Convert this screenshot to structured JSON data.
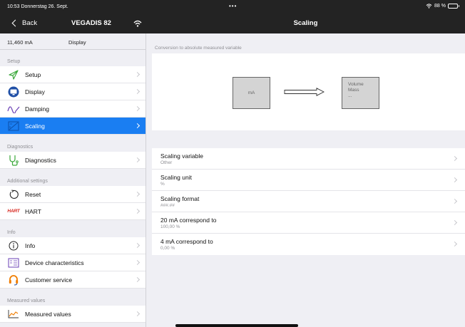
{
  "status": {
    "time": "10:53",
    "date": "Donnerstag 26. Sept.",
    "battery": "88 %",
    "battery_level": 0.88
  },
  "nav": {
    "back_label": "Back",
    "device_name": "VEGADIS 82",
    "title": "Scaling"
  },
  "sidebar": {
    "current_value": "11,460 mA",
    "display_label": "Display",
    "sections": [
      {
        "header": "Setup",
        "items": [
          {
            "label": "Setup",
            "icon": "setup-icon"
          },
          {
            "label": "Display",
            "icon": "display-icon"
          },
          {
            "label": "Damping",
            "icon": "damping-icon"
          },
          {
            "label": "Scaling",
            "icon": "scaling-icon",
            "active": true
          }
        ]
      },
      {
        "header": "Diagnostics",
        "items": [
          {
            "label": "Diagnostics",
            "icon": "stethoscope-icon"
          }
        ]
      },
      {
        "header": "Additional settings",
        "items": [
          {
            "label": "Reset",
            "icon": "reset-icon"
          },
          {
            "label": "HART",
            "icon": "hart-logo-icon",
            "icon_text": "HART"
          }
        ]
      },
      {
        "header": "Info",
        "items": [
          {
            "label": "Info",
            "icon": "info-icon"
          },
          {
            "label": "Device characteristics",
            "icon": "device-characteristics-icon"
          },
          {
            "label": "Customer service",
            "icon": "headset-icon"
          }
        ]
      },
      {
        "header": "Measured values",
        "items": [
          {
            "label": "Measured values",
            "icon": "chart-icon"
          }
        ]
      }
    ]
  },
  "main": {
    "caption": "Conversion to absolute measured variable",
    "diagram": {
      "input_label": "mA",
      "output_lines": [
        "Volume",
        "Mass",
        "..."
      ]
    },
    "rows": [
      {
        "label": "Scaling variable",
        "value": "Other"
      },
      {
        "label": "Scaling unit",
        "value": "%"
      },
      {
        "label": "Scaling format",
        "value": "###.##"
      },
      {
        "label": "20 mA correspond to",
        "value": "100,00 %"
      },
      {
        "label": "4 mA correspond to",
        "value": "0,00 %"
      }
    ]
  },
  "colors": {
    "accent": "#1a7ef2",
    "bar": "#232323",
    "hart_red": "#d7261e",
    "setup_green": "#3aa83a",
    "headset_orange": "#f07d00"
  }
}
